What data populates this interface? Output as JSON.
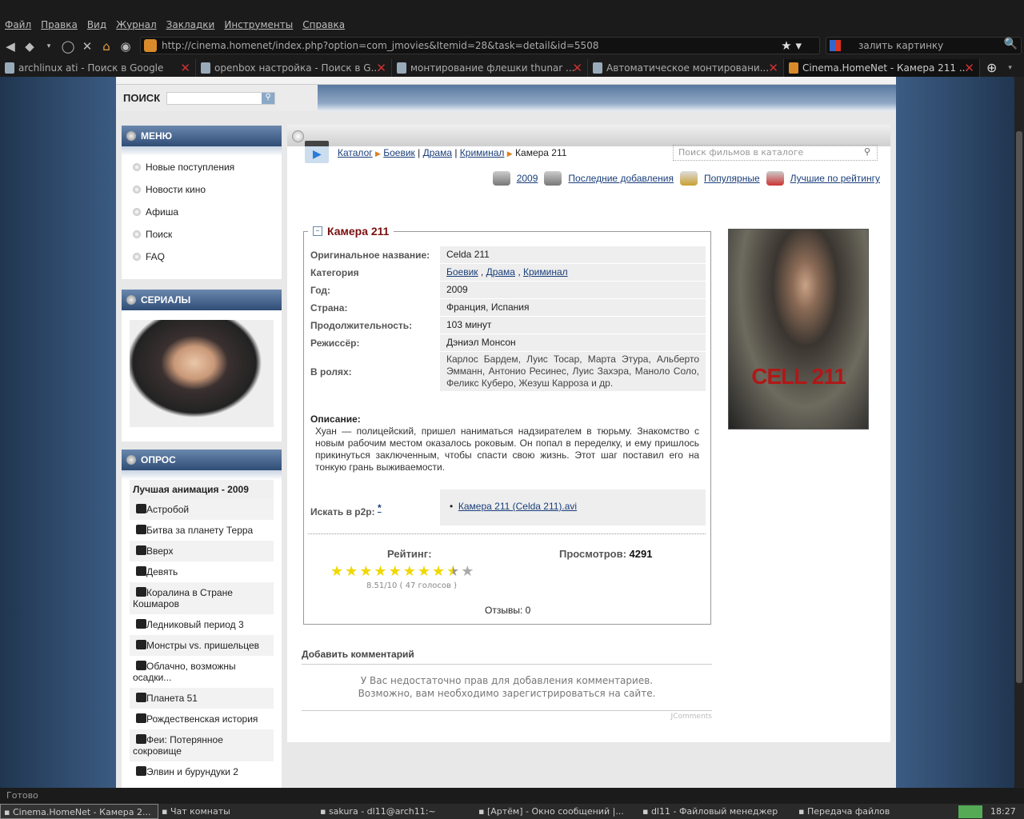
{
  "browser": {
    "menu": [
      "Файл",
      "Правка",
      "Вид",
      "Журнал",
      "Закладки",
      "Инструменты",
      "Справка"
    ],
    "url": "http://cinema.homenet/index.php?option=com_jmovies&Itemid=28&task=detail&id=5508",
    "search_value": "залить картинку",
    "tabs": [
      {
        "label": "archlinux ati - Поиск в Google"
      },
      {
        "label": "openbox настройка - Поиск в G..."
      },
      {
        "label": "монтирование флешки thunar ..."
      },
      {
        "label": "Автоматическое монтировани..."
      },
      {
        "label": "Cinema.HomeNet - Камера 211 ..."
      }
    ],
    "status": "Готово"
  },
  "site": {
    "search_label": "ПОИСК",
    "menu_title": "МЕНЮ",
    "menu_items": [
      "Новые поступления",
      "Новости кино",
      "Афиша",
      "Поиск",
      "FAQ"
    ],
    "series_title": "СЕРИАЛЫ",
    "poll_title": "ОПРОС",
    "poll_question": "Лучшая анимация - 2009",
    "poll_options": [
      "Астробой",
      "Битва за планету Терра",
      "Вверх",
      "Девять",
      "Коралина в Стране Кошмаров",
      "Ледниковый период 3",
      "Монстры vs. пришельцев",
      "Облачно, возможны осадки...",
      "Планета 51",
      "Рождественская история",
      "Феи: Потерянное сокровище",
      "Элвин и бурундуки 2"
    ]
  },
  "movie": {
    "breadcrumb": {
      "catalog": "Каталог",
      "genres": [
        "Боевик",
        "Драма",
        "Криминал"
      ],
      "current": "Камера 211"
    },
    "catalog_search_placeholder": "Поиск фильмов в каталоге",
    "quicklinks": [
      "2009",
      "Последние добавления",
      "Популярные",
      "Лучшие по рейтингу"
    ],
    "title": "Камера 211",
    "fields": [
      {
        "label": "Оригинальное название:",
        "value": "Celda 211"
      },
      {
        "label": "Категория",
        "value": ""
      },
      {
        "label": "Год:",
        "value": "2009"
      },
      {
        "label": "Страна:",
        "value": "Франция, Испания"
      },
      {
        "label": "Продолжительность:",
        "value": "103 минут"
      },
      {
        "label": "Режиссёр:",
        "value": "Дэниэл Монсон"
      },
      {
        "label": "В ролях:",
        "value": "Карлос Бардем, Луис Тосар, Марта Этура, Альберто Эмманн, Антонио Ресинес, Луис Захэра, Маноло Соло, Феликс Куберо, Жезуш Карроза и др."
      }
    ],
    "categories": [
      "Боевик",
      "Драма",
      "Криминал"
    ],
    "description_label": "Описание:",
    "description": "Хуан — полицейский, пришел наниматься надзирателем в тюрьму. Знакомство с новым рабочим местом оказалось роковым. Он попал в переделку, и ему пришлось прикинуться заключенным, чтобы спасти свою жизнь. Этот шаг поставил его на тонкую грань выживаемости.",
    "p2p_label": "Искать в p2p:",
    "p2p_note": "*",
    "p2p_link": "Камера 211 (Celda 211).avi",
    "rating_label": "Рейтинг:",
    "rating_value": 8.51,
    "rating_max": 10,
    "rating_text": "8.51/10 ( 47 голосов )",
    "views_label": "Просмотров:",
    "views": "4291",
    "reviews": "Отзывы: 0",
    "poster_text": "CELL 211",
    "comments_title": "Добавить комментарий",
    "comments_msg1": "У Вас недостаточно прав для добавления комментариев.",
    "comments_msg2": "Возможно, вам необходимо зарегистрироваться на сайте.",
    "comments_brand": "JComments"
  },
  "taskbar": {
    "items": [
      "Cinema.HomeNet - Камера 2...",
      "Чат комнаты",
      "sakura - dl11@arch11:~",
      "[Артём] - Окно сообщений |...",
      "dl11 - Файловый менеджер",
      "Передача файлов"
    ],
    "clock": "18:27"
  }
}
